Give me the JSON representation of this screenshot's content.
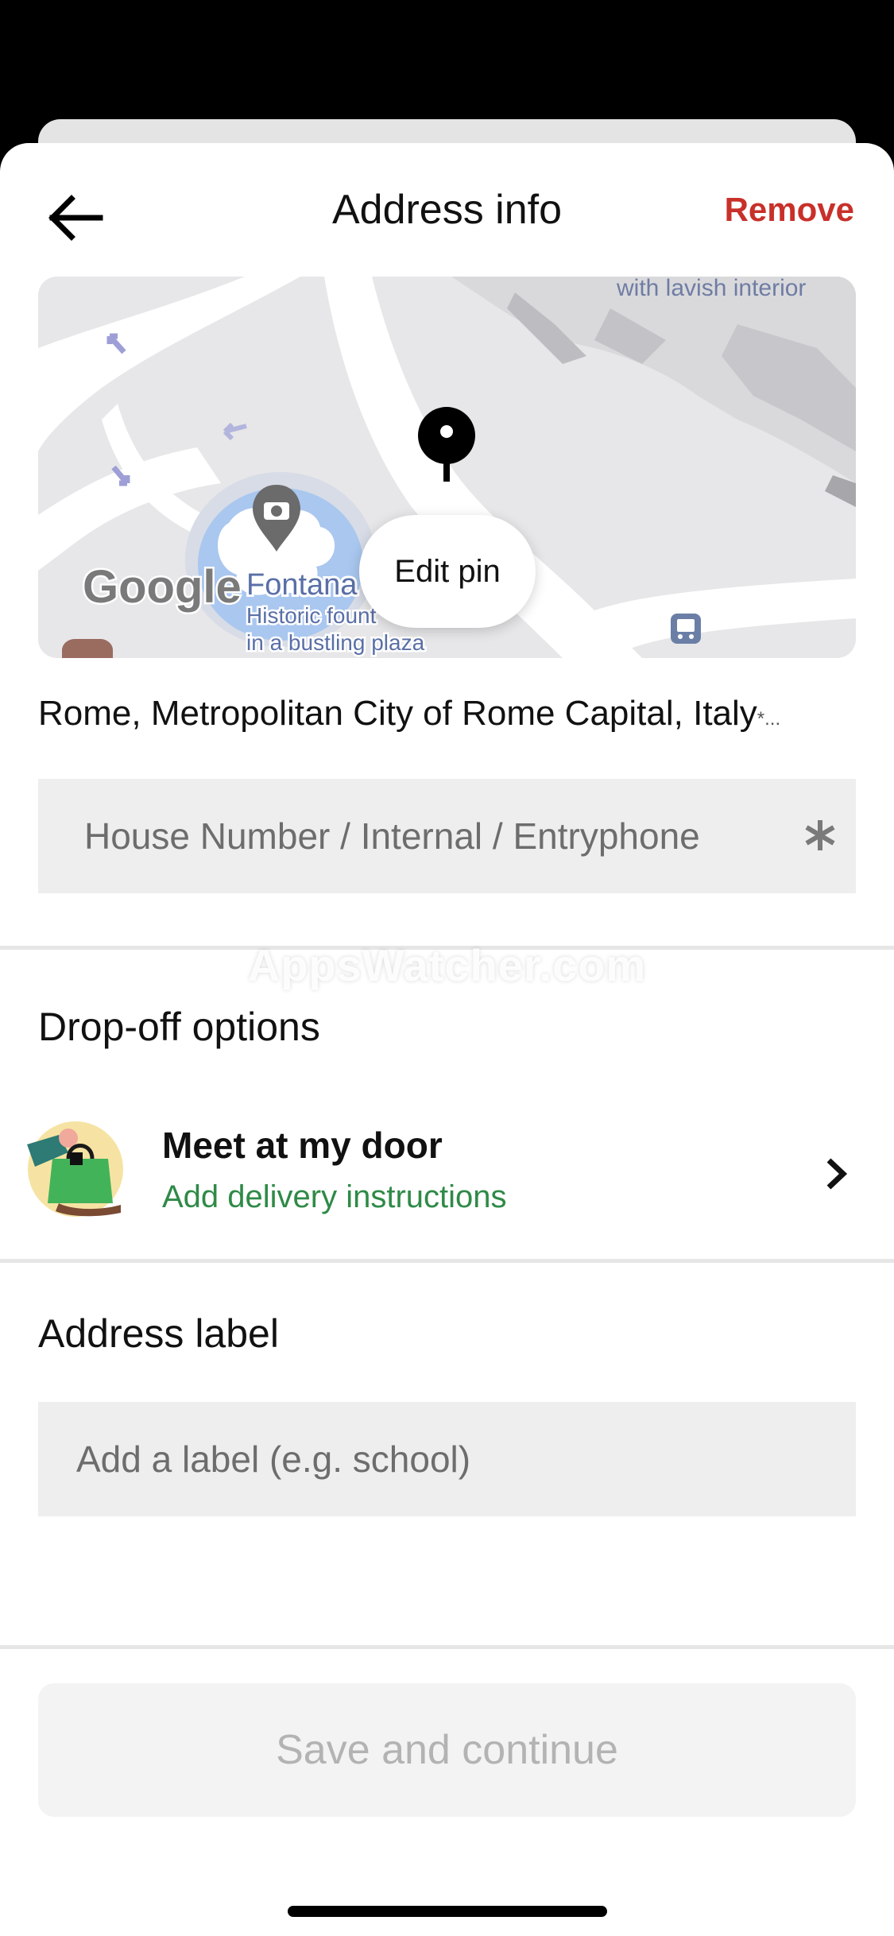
{
  "header": {
    "title": "Address info",
    "remove_label": "Remove"
  },
  "map": {
    "edit_pin_label": "Edit pin",
    "poi_top_label": "with lavish interior",
    "poi_name": "Fontana",
    "poi_desc_line1": "Historic fount",
    "poi_desc_line2": "in a bustling plaza",
    "google_logo": "Google"
  },
  "address": {
    "line": "Rome, Metropolitan City of Rome Capital, Italy",
    "more": "*..."
  },
  "house_input": {
    "placeholder": "House Number / Internal / Entryphone"
  },
  "watermark": "AppsWatcher.com",
  "dropoff": {
    "section_title": "Drop-off options",
    "option_title": "Meet at my door",
    "option_subtitle": "Add delivery instructions"
  },
  "address_label": {
    "section_title": "Address label",
    "placeholder": "Add a label (e.g. school)"
  },
  "footer": {
    "save_label": "Save and continue"
  },
  "colors": {
    "remove": "#c8302a",
    "subtitle_green": "#2f8a47",
    "input_bg": "#eeeeee",
    "disabled_text": "#b3b3b3"
  }
}
